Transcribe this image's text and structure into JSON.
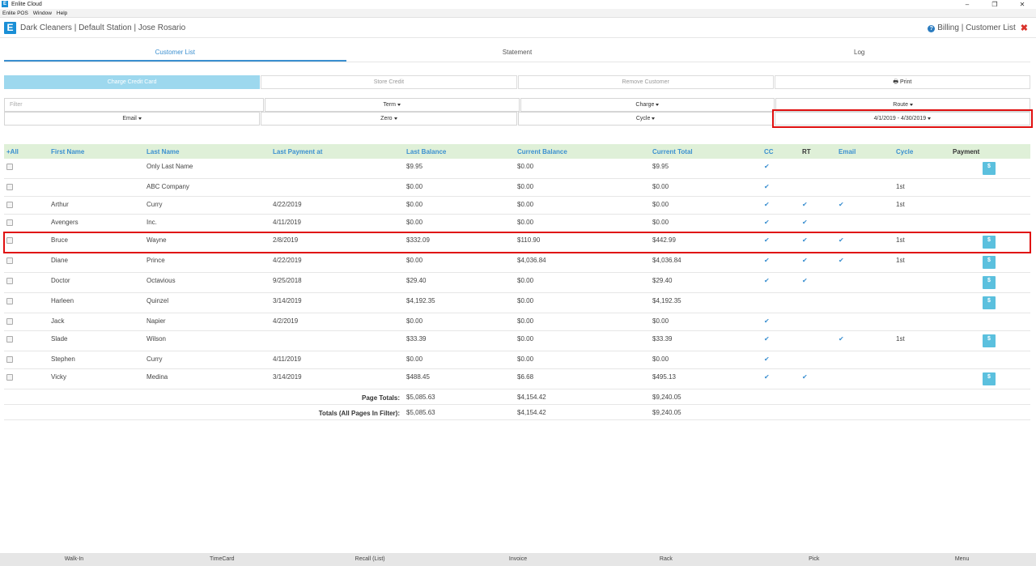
{
  "window": {
    "title": "Enlite Cloud",
    "logo_letter": "E",
    "min": "–",
    "max": "❐",
    "close": "✕"
  },
  "menu": [
    "Enlite POS",
    "Window",
    "Help"
  ],
  "header": {
    "logo_letter": "E",
    "company": "Dark Cleaners | Default Station | Jose Rosario",
    "help_glyph": "?",
    "context": "Billing | Customer List",
    "close_glyph": "✖"
  },
  "tabs": [
    "Customer List",
    "Statement",
    "Log"
  ],
  "actions": {
    "charge": "Charge Credit Card",
    "store": "Store Credit",
    "remove": "Remove Customer",
    "print_icon": "🖶",
    "print": "Print"
  },
  "filters": {
    "filter_placeholder": "Filter",
    "term": "Term",
    "charge": "Charge",
    "route": "Route",
    "email": "Email",
    "zero": "Zero",
    "cycle": "Cycle",
    "date_range": "4/1/2019 - 4/30/2019"
  },
  "columns": {
    "sel": "+All",
    "first": "First Name",
    "last": "Last Name",
    "last_payment": "Last Payment at",
    "last_balance": "Last Balance",
    "current_balance": "Current Balance",
    "current_total": "Current Total",
    "cc": "CC",
    "rt": "RT",
    "email": "Email",
    "cycle": "Cycle",
    "payment": "Payment"
  },
  "check_glyph": "✔",
  "pay_glyph": "$",
  "rows": [
    {
      "first": "",
      "last": "Only Last Name",
      "pay": "",
      "lb": "$9.95",
      "cb": "$0.00",
      "ct": "$9.95",
      "cc": true,
      "rt": false,
      "email": false,
      "cycle": "",
      "payment": true
    },
    {
      "first": "",
      "last": "ABC Company",
      "pay": "",
      "lb": "$0.00",
      "cb": "$0.00",
      "ct": "$0.00",
      "cc": true,
      "rt": false,
      "email": false,
      "cycle": "1st",
      "payment": false
    },
    {
      "first": "Arthur",
      "last": "Curry",
      "pay": "4/22/2019",
      "lb": "$0.00",
      "cb": "$0.00",
      "ct": "$0.00",
      "cc": true,
      "rt": true,
      "email": true,
      "cycle": "1st",
      "payment": false
    },
    {
      "first": "Avengers",
      "last": "Inc.",
      "pay": "4/11/2019",
      "lb": "$0.00",
      "cb": "$0.00",
      "ct": "$0.00",
      "cc": true,
      "rt": true,
      "email": false,
      "cycle": "",
      "payment": false
    },
    {
      "first": "Bruce",
      "last": "Wayne",
      "pay": "2/8/2019",
      "lb": "$332.09",
      "cb": "$110.90",
      "ct": "$442.99",
      "cc": true,
      "rt": true,
      "email": true,
      "cycle": "1st",
      "payment": true,
      "highlight": true
    },
    {
      "first": "Diane",
      "last": "Prince",
      "pay": "4/22/2019",
      "lb": "$0.00",
      "cb": "$4,036.84",
      "ct": "$4,036.84",
      "cc": true,
      "rt": true,
      "email": true,
      "cycle": "1st",
      "payment": true
    },
    {
      "first": "Doctor",
      "last": "Octavious",
      "pay": "9/25/2018",
      "lb": "$29.40",
      "cb": "$0.00",
      "ct": "$29.40",
      "cc": true,
      "rt": true,
      "email": false,
      "cycle": "",
      "payment": true
    },
    {
      "first": "Harleen",
      "last": "Quinzel",
      "pay": "3/14/2019",
      "lb": "$4,192.35",
      "cb": "$0.00",
      "ct": "$4,192.35",
      "cc": false,
      "rt": false,
      "email": false,
      "cycle": "",
      "payment": true
    },
    {
      "first": "Jack",
      "last": "Napier",
      "pay": "4/2/2019",
      "lb": "$0.00",
      "cb": "$0.00",
      "ct": "$0.00",
      "cc": true,
      "rt": false,
      "email": false,
      "cycle": "",
      "payment": false
    },
    {
      "first": "Slade",
      "last": "Wilson",
      "pay": "",
      "lb": "$33.39",
      "cb": "$0.00",
      "ct": "$33.39",
      "cc": true,
      "rt": false,
      "email": true,
      "cycle": "1st",
      "payment": true
    },
    {
      "first": "Stephen",
      "last": "Curry",
      "pay": "4/11/2019",
      "lb": "$0.00",
      "cb": "$0.00",
      "ct": "$0.00",
      "cc": true,
      "rt": false,
      "email": false,
      "cycle": "",
      "payment": false
    },
    {
      "first": "Vicky",
      "last": "Medina",
      "pay": "3/14/2019",
      "lb": "$488.45",
      "cb": "$6.68",
      "ct": "$495.13",
      "cc": true,
      "rt": true,
      "email": false,
      "cycle": "",
      "payment": true
    }
  ],
  "totals": [
    {
      "label": "Page Totals:",
      "lb": "$5,085.63",
      "cb": "$4,154.42",
      "ct": "$9,240.05"
    },
    {
      "label": "Totals (All Pages In Filter):",
      "lb": "$5,085.63",
      "cb": "$4,154.42",
      "ct": "$9,240.05"
    }
  ],
  "bottom_nav": [
    "Walk-In",
    "TimeCard",
    "Recall (List)",
    "Invoice",
    "Rack",
    "Pick",
    "Menu"
  ],
  "colors": {
    "accent": "#3a8fd0",
    "header_bg": "#dff0d8",
    "pay_button": "#5bc0de",
    "highlight": "#e01010"
  }
}
